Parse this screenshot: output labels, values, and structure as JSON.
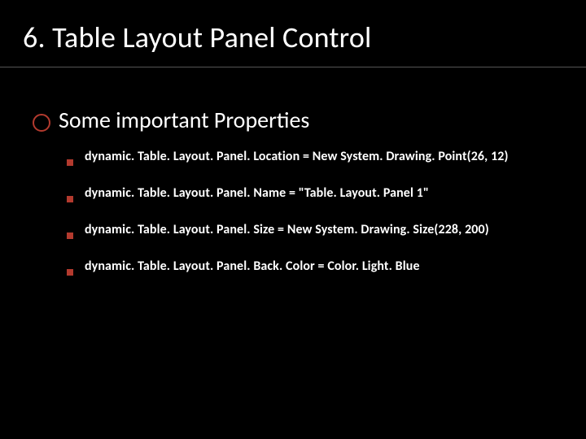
{
  "slide": {
    "title": "6. Table Layout Panel Control",
    "heading": "Some important Properties",
    "items": [
      "dynamic. Table. Layout. Panel. Location = New System. Drawing. Point(26, 12)",
      "dynamic. Table. Layout. Panel. Name = \"Table. Layout. Panel 1\"",
      "dynamic. Table. Layout. Panel. Size = New System. Drawing. Size(228, 200)",
      "dynamic. Table. Layout. Panel. Back. Color = Color. Light. Blue"
    ]
  },
  "colors": {
    "accent": "#b33a2e",
    "background": "#000000",
    "text": "#ffffff"
  }
}
